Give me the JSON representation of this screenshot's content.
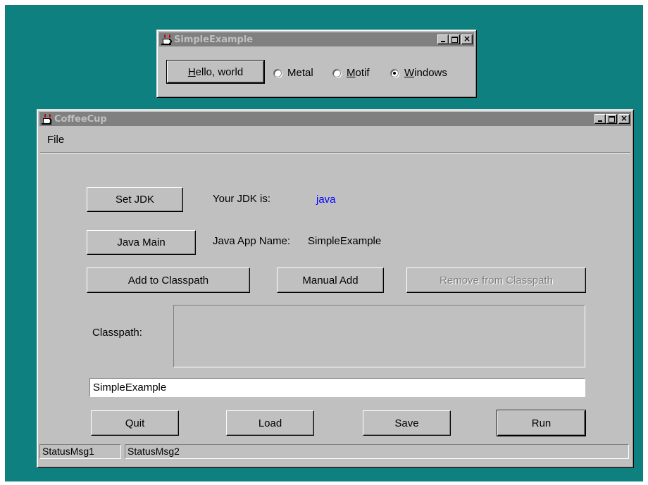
{
  "simple_example": {
    "title": "SimpleExample",
    "hello_button": {
      "mnemonic": "H",
      "rest": "ello, world"
    },
    "radios": [
      {
        "label": "Metal",
        "mnemonic": "",
        "rest": "Metal",
        "checked": false
      },
      {
        "label": "Motif",
        "mnemonic": "M",
        "rest": "otif",
        "checked": false
      },
      {
        "label": "Windows",
        "mnemonic": "W",
        "rest": "indows",
        "checked": true
      }
    ]
  },
  "coffeecup": {
    "title": "CoffeeCup",
    "menu": {
      "file": "File"
    },
    "set_jdk_button": "Set JDK",
    "jdk_label": "Your JDK is:",
    "jdk_value": "java",
    "jdk_value_color": "#0000ff",
    "java_main_button": "Java Main",
    "app_name_label": "Java App Name:",
    "app_name_value": "SimpleExample",
    "add_classpath_button": "Add to Classpath",
    "manual_add_button": "Manual Add",
    "remove_classpath_button": "Remove from Classpath",
    "classpath_label": "Classpath:",
    "text_field_value": "SimpleExample",
    "quit_button": "Quit",
    "load_button": "Load",
    "save_button": "Save",
    "run_button": "Run",
    "status": {
      "msg1": "StatusMsg1",
      "msg2": "StatusMsg2"
    }
  },
  "colors": {
    "desktop": "#0f8080",
    "window": "#c0c0c0",
    "inactive_title": "#808080"
  }
}
